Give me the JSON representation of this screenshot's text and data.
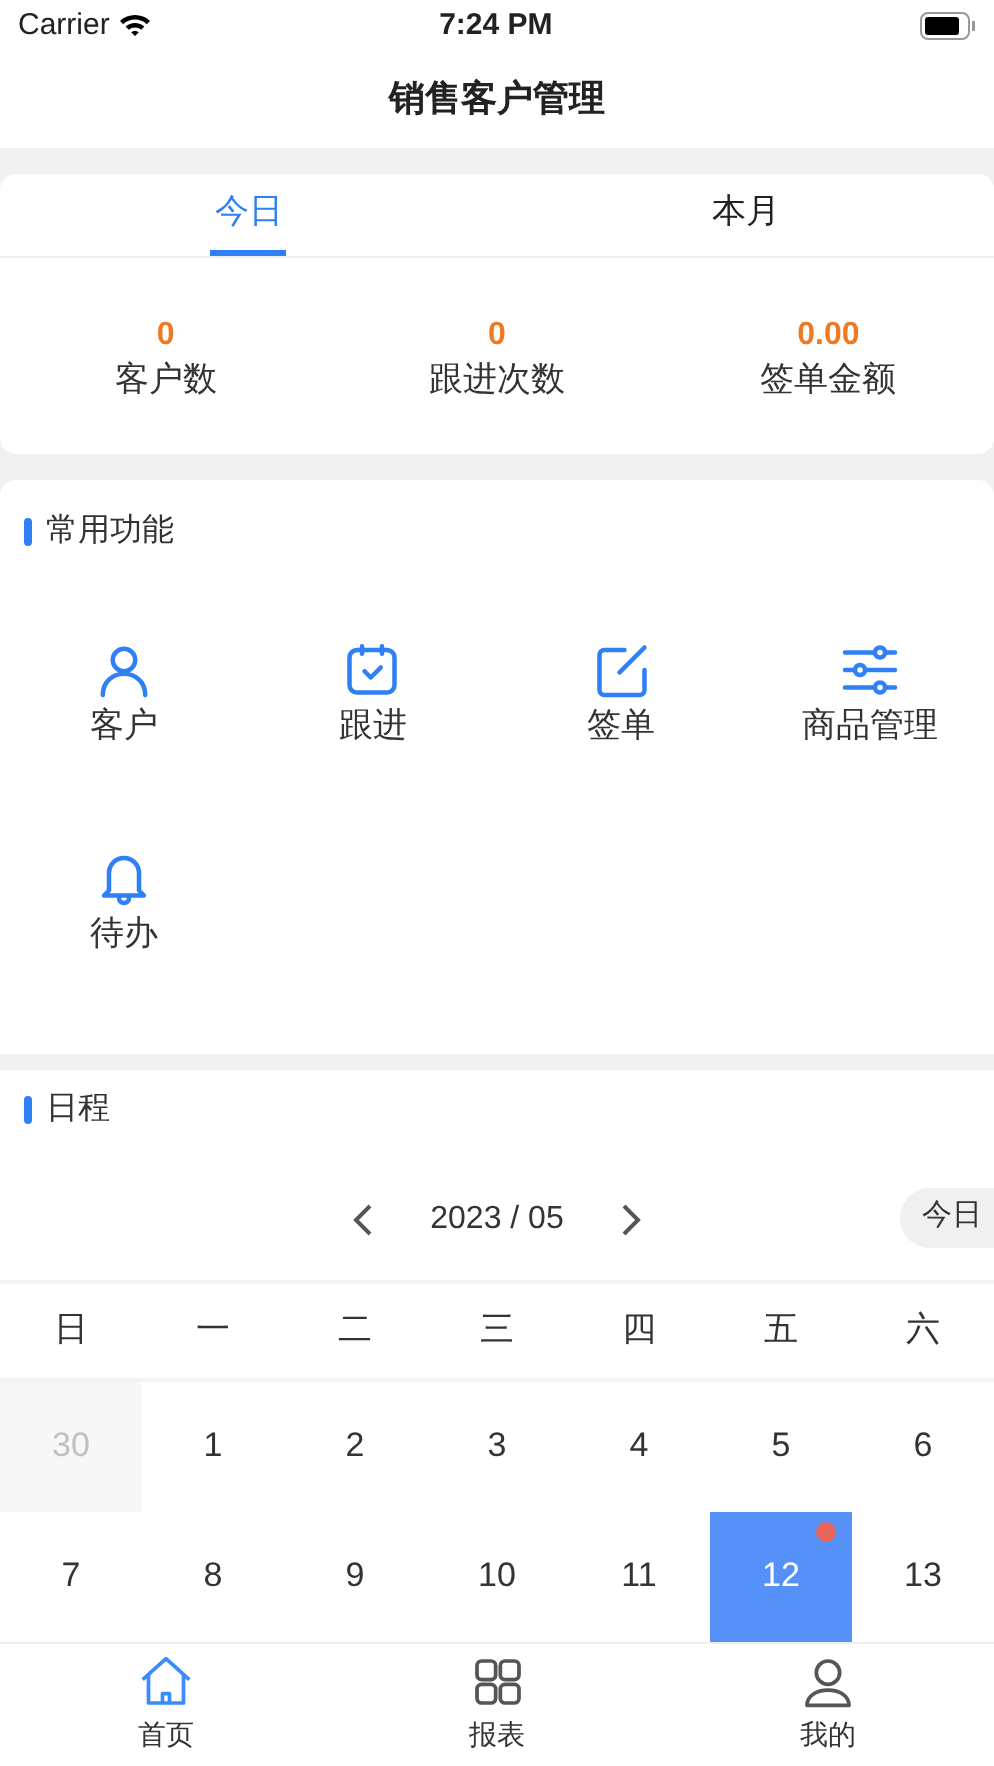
{
  "status_bar": {
    "carrier": "Carrier",
    "time": "7:24 PM"
  },
  "header": {
    "title": "销售客户管理"
  },
  "period_tabs": [
    {
      "label": "今日",
      "selected": true
    },
    {
      "label": "本月",
      "selected": false
    }
  ],
  "stats": [
    {
      "value": "0",
      "label": "客户数"
    },
    {
      "value": "0",
      "label": "跟进次数"
    },
    {
      "value": "0.00",
      "label": "签单金额"
    }
  ],
  "functions": {
    "title": "常用功能",
    "items": [
      {
        "kind": "user",
        "label": "客户"
      },
      {
        "kind": "calendar",
        "label": "跟进"
      },
      {
        "kind": "edit",
        "label": "签单"
      },
      {
        "kind": "sliders",
        "label": "商品管理"
      },
      {
        "kind": "bell",
        "label": "待办"
      }
    ]
  },
  "schedule": {
    "title": "日程",
    "month": "2023 / 05",
    "today_button": "今日",
    "weekdays": [
      "日",
      "一",
      "二",
      "三",
      "四",
      "五",
      "六"
    ],
    "days": [
      {
        "day": "30",
        "muted": true,
        "selected": false,
        "dot": false
      },
      {
        "day": "1",
        "muted": false,
        "selected": false,
        "dot": false
      },
      {
        "day": "2",
        "muted": false,
        "selected": false,
        "dot": false
      },
      {
        "day": "3",
        "muted": false,
        "selected": false,
        "dot": false
      },
      {
        "day": "4",
        "muted": false,
        "selected": false,
        "dot": false
      },
      {
        "day": "5",
        "muted": false,
        "selected": false,
        "dot": false
      },
      {
        "day": "6",
        "muted": false,
        "selected": false,
        "dot": false
      },
      {
        "day": "7",
        "muted": false,
        "selected": false,
        "dot": false
      },
      {
        "day": "8",
        "muted": false,
        "selected": false,
        "dot": false
      },
      {
        "day": "9",
        "muted": false,
        "selected": false,
        "dot": false
      },
      {
        "day": "10",
        "muted": false,
        "selected": false,
        "dot": false
      },
      {
        "day": "11",
        "muted": false,
        "selected": false,
        "dot": false
      },
      {
        "day": "12",
        "muted": false,
        "selected": true,
        "dot": true
      },
      {
        "day": "13",
        "muted": false,
        "selected": false,
        "dot": false
      }
    ]
  },
  "tab_bar": [
    {
      "kind": "home",
      "label": "首页",
      "selected": true
    },
    {
      "kind": "grid",
      "label": "报表",
      "selected": false
    },
    {
      "kind": "person",
      "label": "我的",
      "selected": false
    }
  ]
}
